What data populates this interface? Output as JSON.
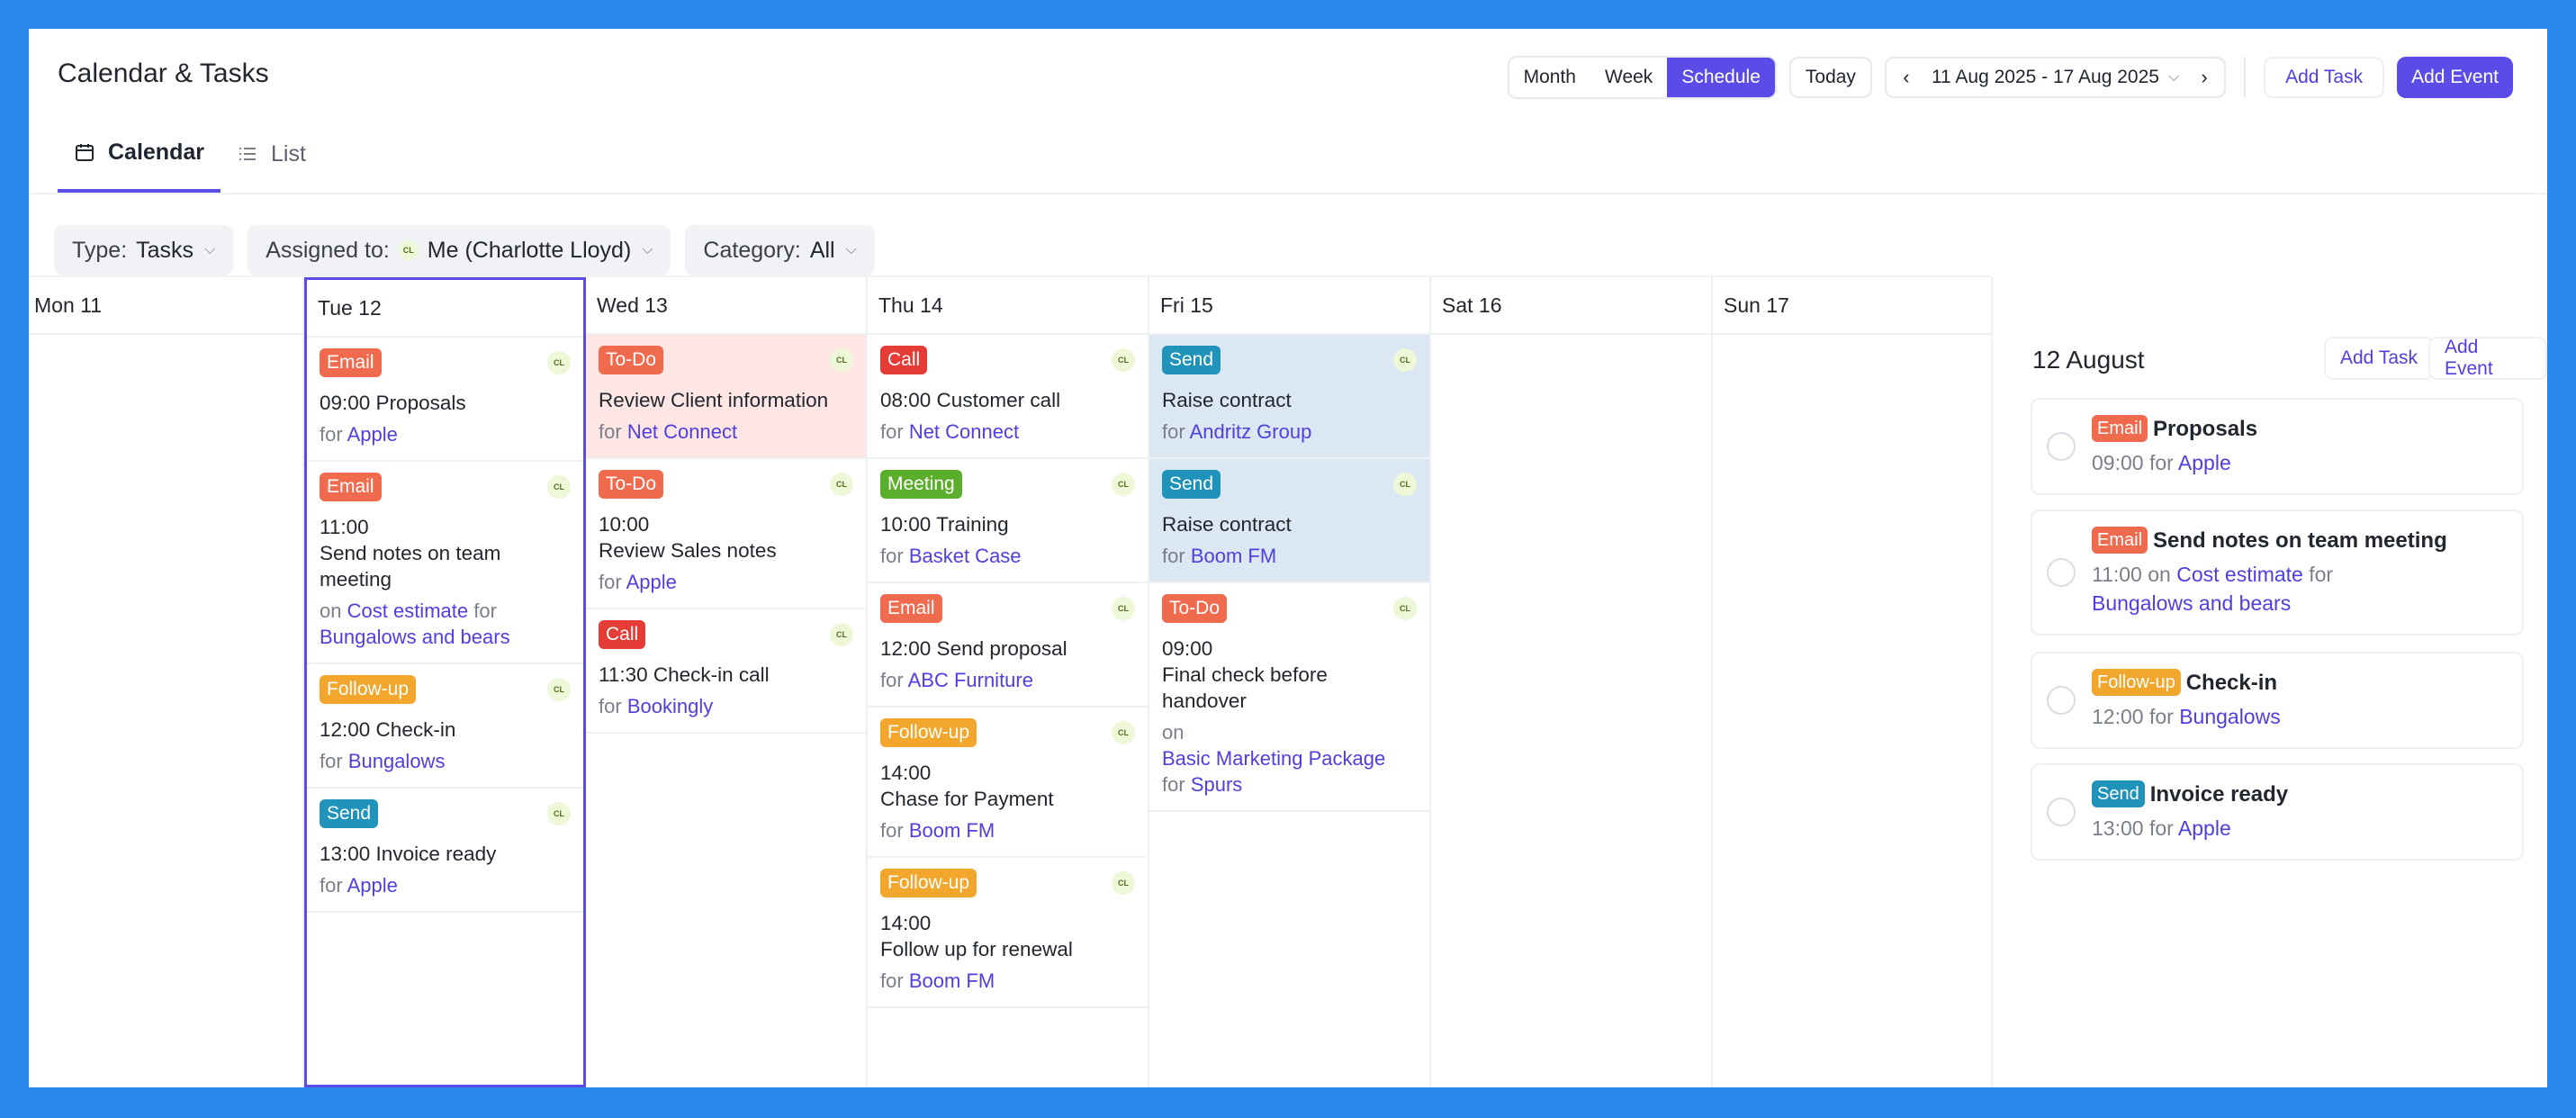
{
  "app": {
    "title": "Calendar & Tasks",
    "tabs": [
      {
        "label": "Calendar"
      },
      {
        "label": "List"
      }
    ],
    "colors": {
      "accent": "#5b4ce8",
      "link": "#4f3fe0",
      "background": "#2a86ea"
    }
  },
  "toolbar": {
    "views": [
      "Month",
      "Week",
      "Schedule"
    ],
    "active_view": "Schedule",
    "today": "Today",
    "range": "11 Aug 2025 - 17 Aug 2025",
    "add_task": "Add Task",
    "add_event": "Add Event"
  },
  "filters": {
    "type_label": "Type:",
    "type_value": "Tasks",
    "assigned_label": "Assigned to:",
    "assigned_avatar": "CL",
    "assigned_value": "Me (Charlotte Lloyd)",
    "category_label": "Category:",
    "category_value": "All"
  },
  "days": [
    {
      "label": "Mon 11"
    },
    {
      "label": "Tue 12"
    },
    {
      "label": "Wed 13"
    },
    {
      "label": "Thu 14"
    },
    {
      "label": "Fri 15"
    },
    {
      "label": "Sat 16"
    },
    {
      "label": "Sun 17"
    }
  ],
  "cards": {
    "tue": [
      {
        "tag": "Email",
        "avatar": "CL",
        "title": "09:00 Proposals",
        "for": "for",
        "link": "Apple"
      },
      {
        "tag": "Email",
        "avatar": "CL",
        "time": "11:00",
        "title": "Send notes on team meeting",
        "on": "on",
        "link1": "Cost estimate",
        "for": "for",
        "link2": "Bungalows and bears"
      },
      {
        "tag": "Follow-up",
        "avatar": "CL",
        "title": "12:00 Check-in",
        "for": "for",
        "link": "Bungalows"
      },
      {
        "tag": "Send",
        "avatar": "CL",
        "title": "13:00 Invoice ready",
        "for": "for",
        "link": "Apple"
      }
    ],
    "wed": [
      {
        "tag": "To-Do",
        "avatar": "CL",
        "title": "Review Client information",
        "for": "for",
        "link": "Net Connect"
      },
      {
        "tag": "To-Do",
        "avatar": "CL",
        "time": "10:00",
        "title": "Review Sales notes",
        "for": "for",
        "link": "Apple"
      },
      {
        "tag": "Call",
        "avatar": "CL",
        "title": "11:30 Check-in call",
        "for": "for",
        "link": "Bookingly"
      }
    ],
    "thu": [
      {
        "tag": "Call",
        "avatar": "CL",
        "title": "08:00 Customer call",
        "for": "for",
        "link": "Net Connect"
      },
      {
        "tag": "Meeting",
        "avatar": "CL",
        "title": "10:00 Training",
        "for": "for",
        "link": "Basket Case"
      },
      {
        "tag": "Email",
        "avatar": "CL",
        "title": "12:00 Send proposal",
        "for": "for",
        "link": "ABC Furniture"
      },
      {
        "tag": "Follow-up",
        "avatar": "CL",
        "time": "14:00",
        "title": "Chase for Payment",
        "for": "for",
        "link": "Boom FM"
      },
      {
        "tag": "Follow-up",
        "avatar": "CL",
        "time": "14:00",
        "title": "Follow up for renewal",
        "for": "for",
        "link": "Boom FM"
      }
    ],
    "fri": [
      {
        "tag": "Send",
        "avatar": "CL",
        "title": "Raise contract",
        "for": "for",
        "link": "Andritz Group"
      },
      {
        "tag": "Send",
        "avatar": "CL",
        "title": "Raise contract",
        "for": "for",
        "link": "Boom FM"
      },
      {
        "tag": "To-Do",
        "avatar": "CL",
        "time": "09:00",
        "title": "Final check before handover",
        "on": "on",
        "link1": "Basic Marketing Package",
        "for": "for",
        "link2": "Spurs"
      }
    ]
  },
  "right_panel": {
    "title": "12 August",
    "add_task": "Add Task",
    "add_event": "Add Event",
    "items": [
      {
        "tag": "Email",
        "title": "Proposals",
        "time": "09:00",
        "for": "for",
        "link": "Apple"
      },
      {
        "tag": "Email",
        "title": "Send notes on team meeting",
        "time": "11:00",
        "on": "on",
        "link1": "Cost estimate",
        "for": "for",
        "link2": "Bungalows and bears"
      },
      {
        "tag": "Follow-up",
        "title": "Check-in",
        "time": "12:00",
        "for": "for",
        "link": "Bungalows"
      },
      {
        "tag": "Send",
        "title": "Invoice ready",
        "time": "13:00",
        "for": "for",
        "link": "Apple"
      }
    ]
  }
}
